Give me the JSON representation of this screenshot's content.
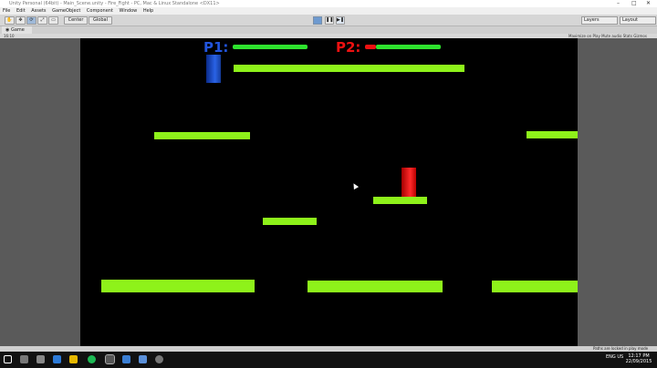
{
  "window": {
    "title": "Unity Personal (64bit) - Main_Scene.unity - Fire_Fight - PC, Mac & Linux Standalone <DX11>"
  },
  "menu": [
    "File",
    "Edit",
    "Assets",
    "GameObject",
    "Component",
    "Window",
    "Help"
  ],
  "toolbar": {
    "pivot_label": "Center",
    "space_label": "Global",
    "layers_label": "Layers",
    "layout_label": "Layout"
  },
  "game_tab": {
    "label": "Game",
    "aspect": "16:10",
    "options": "Maximize on Play   Mute audio   Stats   Gizmos"
  },
  "hud": {
    "p1_label": "P1:",
    "p2_label": "P2:",
    "p1_health": 1.0,
    "p2_health": 0.85,
    "p1_color": "#2255dd",
    "p2_color": "#ee1111"
  },
  "status": {
    "message": "Paths are locked in play mode"
  },
  "taskbar": {
    "time": "12:17 PM",
    "date": "22/09/2015",
    "lang": "ENG US"
  },
  "colors": {
    "platform": "#8ef21a",
    "health": "#2ee32e",
    "background": "#000000"
  }
}
